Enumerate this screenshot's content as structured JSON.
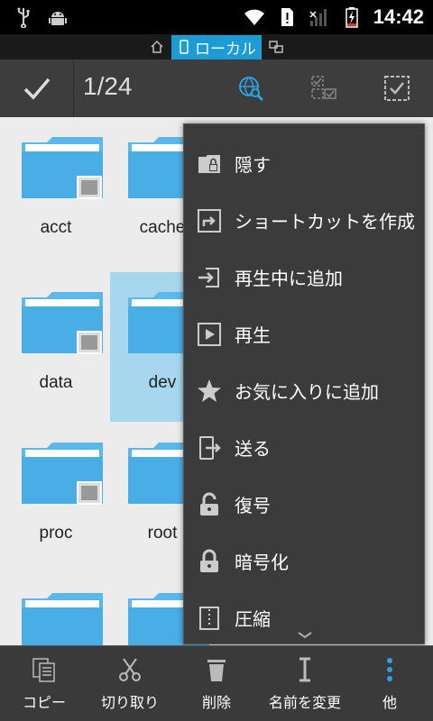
{
  "statusbar": {
    "time": "14:42"
  },
  "location": {
    "label": "ローカル"
  },
  "actionbar": {
    "selection_count": "1/24"
  },
  "folders": [
    {
      "name": "acct",
      "selected": false
    },
    {
      "name": "cache",
      "selected": false
    },
    {
      "name": "data",
      "selected": false
    },
    {
      "name": "dev",
      "selected": true
    },
    {
      "name": "proc",
      "selected": false
    },
    {
      "name": "root",
      "selected": false
    }
  ],
  "menu": {
    "items": [
      {
        "label": "隠す",
        "icon": "hide-folder-icon"
      },
      {
        "label": "ショートカットを作成",
        "icon": "shortcut-icon"
      },
      {
        "label": "再生中に追加",
        "icon": "add-to-playing-icon"
      },
      {
        "label": "再生",
        "icon": "play-icon"
      },
      {
        "label": "お気に入りに追加",
        "icon": "star-icon"
      },
      {
        "label": "送る",
        "icon": "send-icon"
      },
      {
        "label": "復号",
        "icon": "unlock-icon"
      },
      {
        "label": "暗号化",
        "icon": "lock-icon"
      },
      {
        "label": "圧縮",
        "icon": "zip-icon"
      }
    ]
  },
  "bottombar": {
    "copy": "コピー",
    "cut": "切り取り",
    "delete": "削除",
    "rename": "名前を変更",
    "more": "他"
  },
  "colors": {
    "accent": "#1c9bd6",
    "folder": "#5bb8ec",
    "selection": "#a7d7ef",
    "bar": "#3d3d3d"
  }
}
